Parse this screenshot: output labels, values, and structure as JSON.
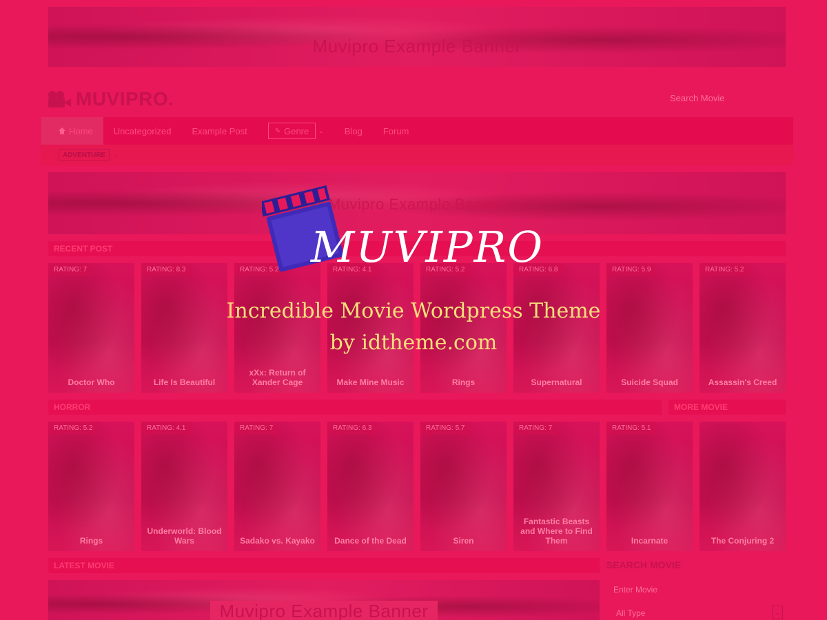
{
  "top_banner": {
    "text": "Muvipro Example Banner"
  },
  "logo": {
    "text": "MUVIPRO."
  },
  "search": {
    "placeholder": "Search Movie"
  },
  "nav": {
    "items": [
      {
        "label": "Home"
      },
      {
        "label": "Uncategorized"
      },
      {
        "label": "Example Post"
      },
      {
        "label": "Genre"
      },
      {
        "label": "Blog"
      },
      {
        "label": "Forum"
      }
    ]
  },
  "subnav": {
    "tag": "ADVENTURE"
  },
  "mid_banner": {
    "text": "Muvipro Example Banner"
  },
  "sections": {
    "recent": "RECENT POST",
    "horror": "HORROR",
    "more": "MORE MOVIE",
    "latest": "LATEST MOVIE"
  },
  "recent_posts": [
    {
      "rating": "RATING: 7",
      "title": "Doctor Who"
    },
    {
      "rating": "RATING: 8.3",
      "title": "Life Is Beautiful"
    },
    {
      "rating": "RATING: 5.2",
      "title": "xXx: Return of Xander Cage"
    },
    {
      "rating": "RATING: 4.1",
      "title": "Make Mine Music"
    },
    {
      "rating": "RATING: 5.2",
      "title": "Rings"
    },
    {
      "rating": "RATING: 6.8",
      "title": "Supernatural"
    },
    {
      "rating": "RATING: 5.9",
      "title": "Suicide Squad"
    },
    {
      "rating": "RATING: 5.2",
      "title": "Assassin's Creed"
    }
  ],
  "horror_posts": [
    {
      "rating": "RATING: 5.2",
      "title": "Rings"
    },
    {
      "rating": "RATING: 4.1",
      "title": "Underworld: Blood Wars"
    },
    {
      "rating": "RATING: 7",
      "title": "Sadako vs. Kayako"
    },
    {
      "rating": "RATING: 6.3",
      "title": "Dance of the Dead"
    },
    {
      "rating": "RATING: 5.7",
      "title": "Siren"
    },
    {
      "rating": "RATING: 7",
      "title": "Fantastic Beasts and Where to Find Them"
    }
  ],
  "more_posts": [
    {
      "rating": "RATING: 5.1",
      "title": "Incarnate"
    },
    {
      "rating": "",
      "title": "The Conjuring 2"
    }
  ],
  "sidebar": {
    "search_title": "SEARCH MOVIE",
    "input_placeholder": "Enter Movie",
    "select_value": "All Type"
  },
  "latest_banner": {
    "text": "Muvipro Example Banner"
  },
  "overlay": {
    "title": "MUVIPRO",
    "subtitle_line1": "Incredible Movie Wordpress Theme",
    "subtitle_line2": "by idtheme.com"
  }
}
